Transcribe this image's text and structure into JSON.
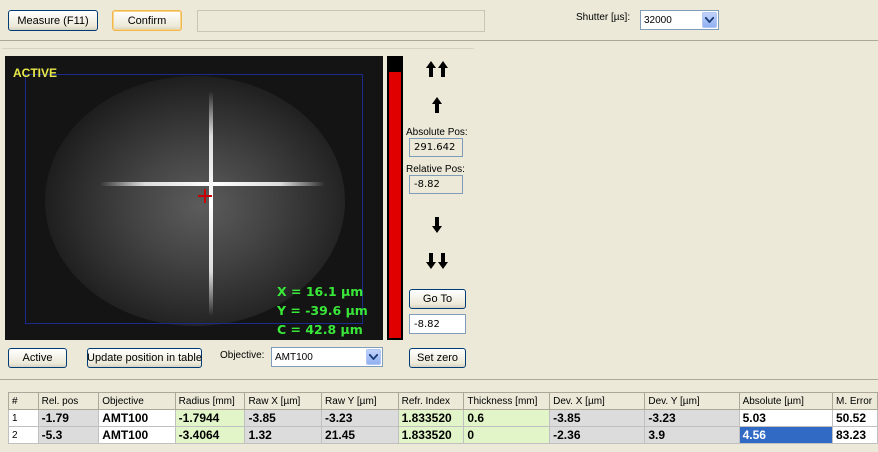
{
  "toolbar": {
    "measure_label": "Measure (F11)",
    "confirm_label": "Confirm",
    "status_text": "",
    "shutter_label": "Shutter [µs]:",
    "shutter_value": "32000"
  },
  "camera": {
    "state_label": "ACTIVE",
    "x_readout": "X = 16.1 µm",
    "y_readout": "Y = -39.6 µm",
    "c_readout": "C = 42.8 µm",
    "level_fraction": 0.95,
    "colors": {
      "crosshair": "#c80000",
      "readout": "#39e839",
      "state": "#e8e84a",
      "level": "#e00000"
    }
  },
  "position": {
    "fast_up_icon": "double-arrow-up-icon",
    "up_icon": "arrow-up-icon",
    "absolute_label": "Absolute Pos:",
    "absolute_value": "291.642",
    "relative_label": "Relative Pos:",
    "relative_value": "-8.82",
    "down_icon": "arrow-down-icon",
    "fast_down_icon": "double-arrow-down-icon",
    "goto_label": "Go To",
    "goto_value": "-8.82",
    "set_zero_label": "Set zero"
  },
  "controls": {
    "active_label": "Active",
    "update_label": "Update position in table",
    "objective_label": "Objective:",
    "objective_value": "AMT100"
  },
  "table": {
    "headers": [
      "#",
      "Rel. pos",
      "Objective",
      "Radius [mm]",
      "Raw X [µm]",
      "Raw Y [µm]",
      "Refr. Index",
      "Thickness [mm]",
      "Dev. X [µm]",
      "Dev. Y [µm]",
      "Absolute [µm]",
      "M. Error"
    ],
    "rows": [
      [
        "1",
        "-1.79",
        "AMT100",
        "-1.7944",
        "-3.85",
        "-3.23",
        "1.833520",
        "0.6",
        "-3.85",
        "-3.23",
        "5.03",
        "50.52"
      ],
      [
        "2",
        "-5.3",
        "AMT100",
        "-3.4064",
        "1.32",
        "21.45",
        "1.833520",
        "0",
        "-2.36",
        "3.9",
        "4.56",
        "83.23"
      ]
    ]
  }
}
